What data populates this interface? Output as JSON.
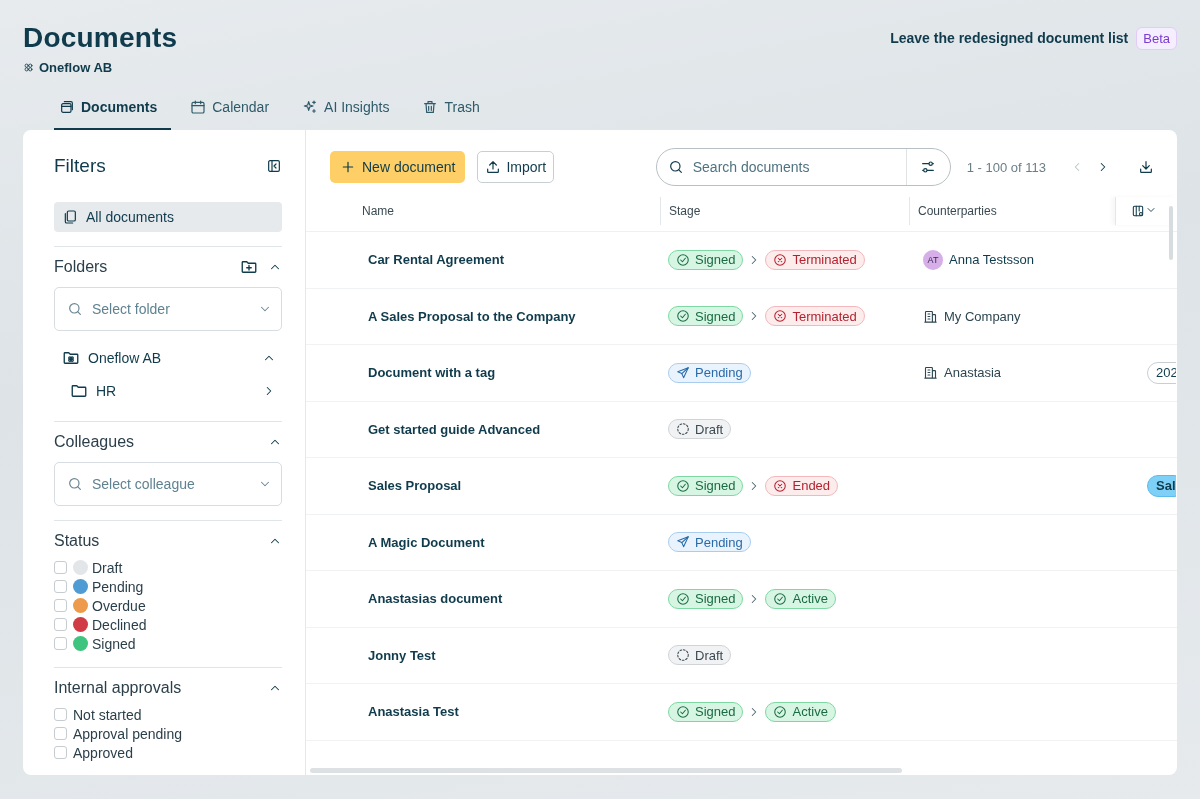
{
  "page": {
    "title": "Documents",
    "workspace": "Oneflow AB",
    "leave_link": "Leave the redesigned document list",
    "beta_badge": "Beta"
  },
  "tabs": [
    {
      "label": "Documents",
      "selected": true
    },
    {
      "label": "Calendar",
      "selected": false
    },
    {
      "label": "AI Insights",
      "selected": false
    },
    {
      "label": "Trash",
      "selected": false
    }
  ],
  "filters": {
    "title": "Filters",
    "all_documents": {
      "label": "All documents",
      "selected": true
    },
    "folders": {
      "title": "Folders",
      "expanded": true,
      "placeholder": "Select folder",
      "tree": [
        {
          "label": "Oneflow AB",
          "expanded": true,
          "children": [
            {
              "label": "HR",
              "expanded": false
            }
          ]
        }
      ]
    },
    "colleagues": {
      "title": "Colleagues",
      "expanded": true,
      "placeholder": "Select colleague"
    },
    "status": {
      "title": "Status",
      "expanded": true,
      "items": [
        {
          "label": "Draft",
          "color": "#e3e6e9",
          "checked": false
        },
        {
          "label": "Pending",
          "color": "#4f9bd4",
          "checked": false
        },
        {
          "label": "Overdue",
          "color": "#ee9a4c",
          "checked": false
        },
        {
          "label": "Declined",
          "color": "#d13b45",
          "checked": false
        },
        {
          "label": "Signed",
          "color": "#3ec47e",
          "checked": false
        }
      ]
    },
    "approvals": {
      "title": "Internal approvals",
      "expanded": true,
      "items": [
        {
          "label": "Not started",
          "checked": false
        },
        {
          "label": "Approval pending",
          "checked": false
        },
        {
          "label": "Approved",
          "checked": false
        }
      ]
    }
  },
  "toolbar": {
    "new_document": "New document",
    "import": "Import",
    "search_placeholder": "Search documents",
    "pagination": "1 - 100 of 113"
  },
  "table": {
    "columns": [
      "Name",
      "Stage",
      "Counterparties"
    ],
    "rows": [
      {
        "name": "Car Rental Agreement",
        "stages": [
          {
            "label": "Signed",
            "kind": "signed"
          },
          {
            "label": "Terminated",
            "kind": "terminated"
          }
        ],
        "counterparty": {
          "kind": "person",
          "initials": "AT",
          "name": "Anna Testsson"
        }
      },
      {
        "name": "A Sales Proposal to the Company",
        "stages": [
          {
            "label": "Signed",
            "kind": "signed"
          },
          {
            "label": "Terminated",
            "kind": "terminated"
          }
        ],
        "counterparty": {
          "kind": "company",
          "name": "My Company"
        }
      },
      {
        "name": "Document with a tag",
        "stages": [
          {
            "label": "Pending",
            "kind": "pending"
          }
        ],
        "counterparty": {
          "kind": "company",
          "name": "Anastasia"
        },
        "column_4": {
          "text": "202",
          "kind": "outline"
        }
      },
      {
        "name": "Get started guide Advanced",
        "stages": [
          {
            "label": "Draft",
            "kind": "draft"
          }
        ]
      },
      {
        "name": "Sales Proposal",
        "stages": [
          {
            "label": "Signed",
            "kind": "signed"
          },
          {
            "label": "Ended",
            "kind": "ended"
          }
        ],
        "column_4": {
          "text": "Sal",
          "kind": "filled"
        }
      },
      {
        "name": "A Magic Document",
        "stages": [
          {
            "label": "Pending",
            "kind": "pending"
          }
        ]
      },
      {
        "name": "Anastasias document",
        "stages": [
          {
            "label": "Signed",
            "kind": "signed"
          },
          {
            "label": "Active",
            "kind": "active"
          }
        ]
      },
      {
        "name": "Jonny Test",
        "stages": [
          {
            "label": "Draft",
            "kind": "draft"
          }
        ]
      },
      {
        "name": "Anastasia Test",
        "stages": [
          {
            "label": "Signed",
            "kind": "signed"
          },
          {
            "label": "Active",
            "kind": "active"
          }
        ]
      }
    ]
  }
}
